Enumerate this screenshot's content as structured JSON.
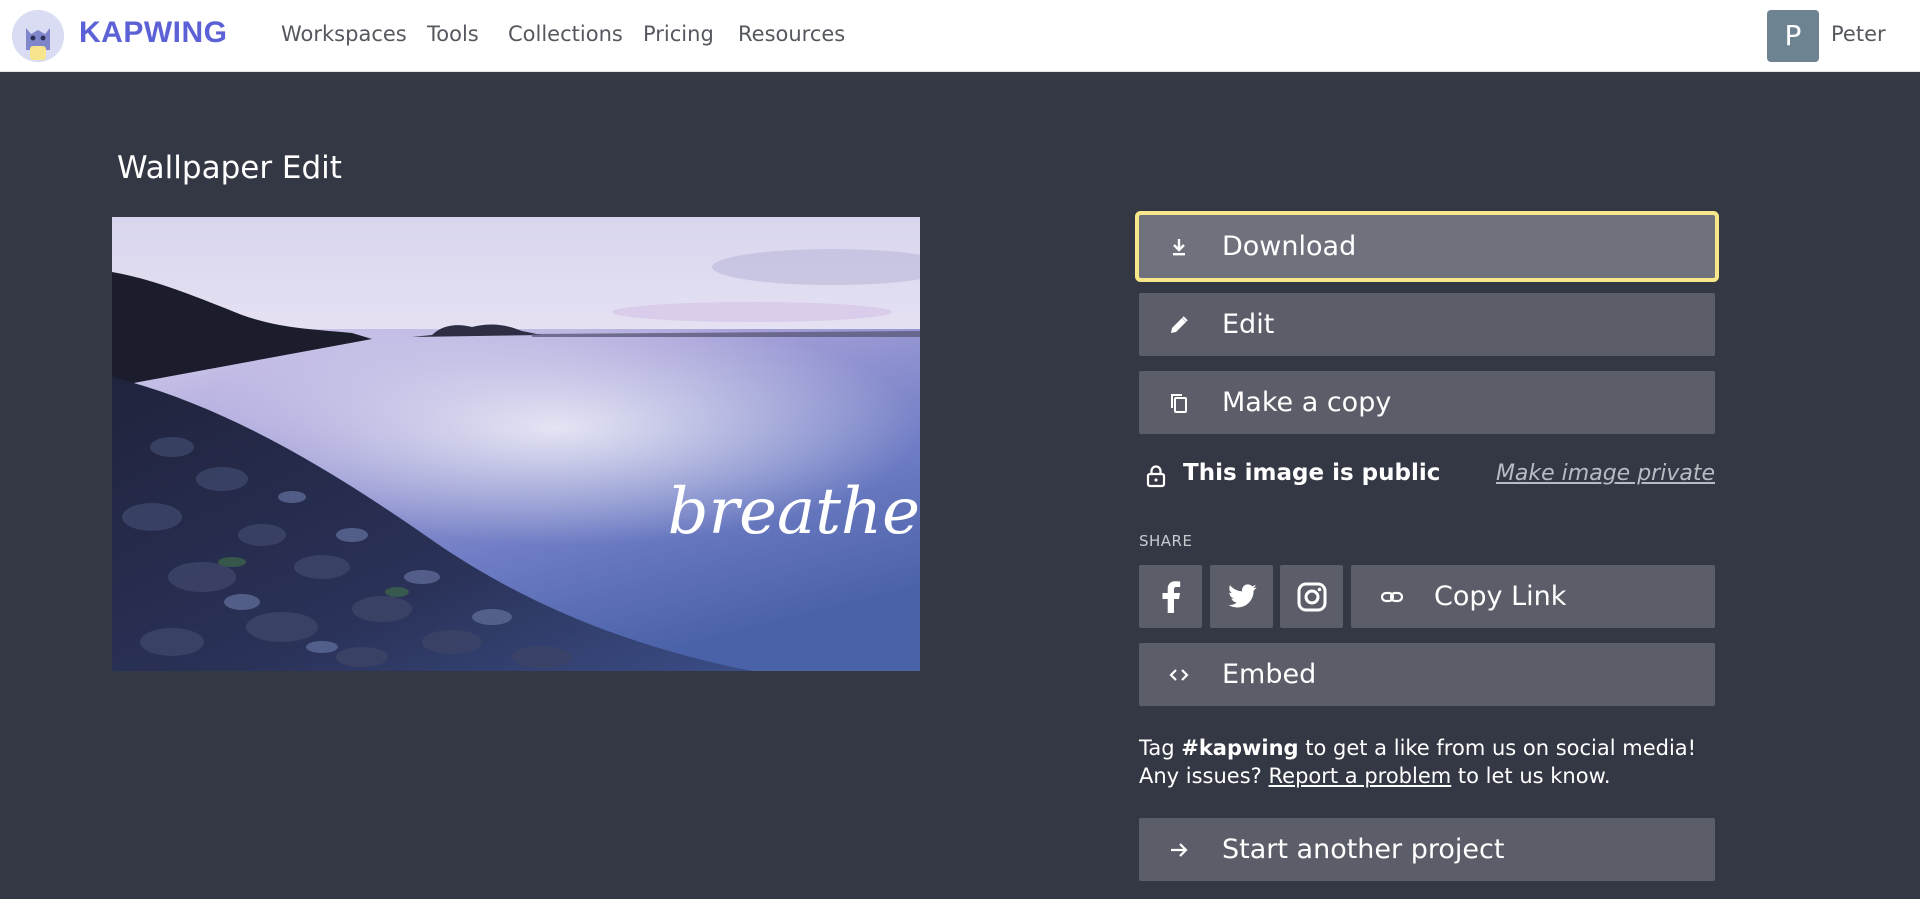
{
  "header": {
    "brand": "KAPWING",
    "nav": [
      {
        "label": "Workspaces"
      },
      {
        "label": "Tools"
      },
      {
        "label": "Collections"
      },
      {
        "label": "Pricing"
      },
      {
        "label": "Resources"
      }
    ],
    "user": {
      "initial": "P",
      "name": "Peter"
    }
  },
  "main": {
    "title": "Wallpaper Edit",
    "preview": {
      "overlay_text": "breathe"
    }
  },
  "actions": {
    "download": {
      "label": "Download",
      "icon": "download-icon"
    },
    "edit": {
      "label": "Edit",
      "icon": "pencil-icon"
    },
    "copy": {
      "label": "Make a copy",
      "icon": "copy-icon"
    },
    "visibility": {
      "status": "This image is public",
      "toggle": "Make image private",
      "icon": "lock-icon"
    },
    "share": {
      "label": "SHARE",
      "facebook_icon": "facebook-icon",
      "twitter_icon": "twitter-icon",
      "instagram_icon": "instagram-icon",
      "copy_link": "Copy Link"
    },
    "embed": {
      "label": "Embed",
      "icon": "code-icon"
    },
    "info": {
      "prefix": "Tag ",
      "tag": "#kapwing",
      "middle": " to get a like from us on social media! Any issues? ",
      "link": "Report a problem",
      "suffix": " to let us know."
    },
    "start": {
      "label": "Start another project",
      "icon": "arrow-right-icon"
    }
  },
  "colors": {
    "background": "#343744",
    "button": "#5b5d68",
    "highlight_outline": "#f7e68a",
    "brand": "#5c62d6"
  }
}
